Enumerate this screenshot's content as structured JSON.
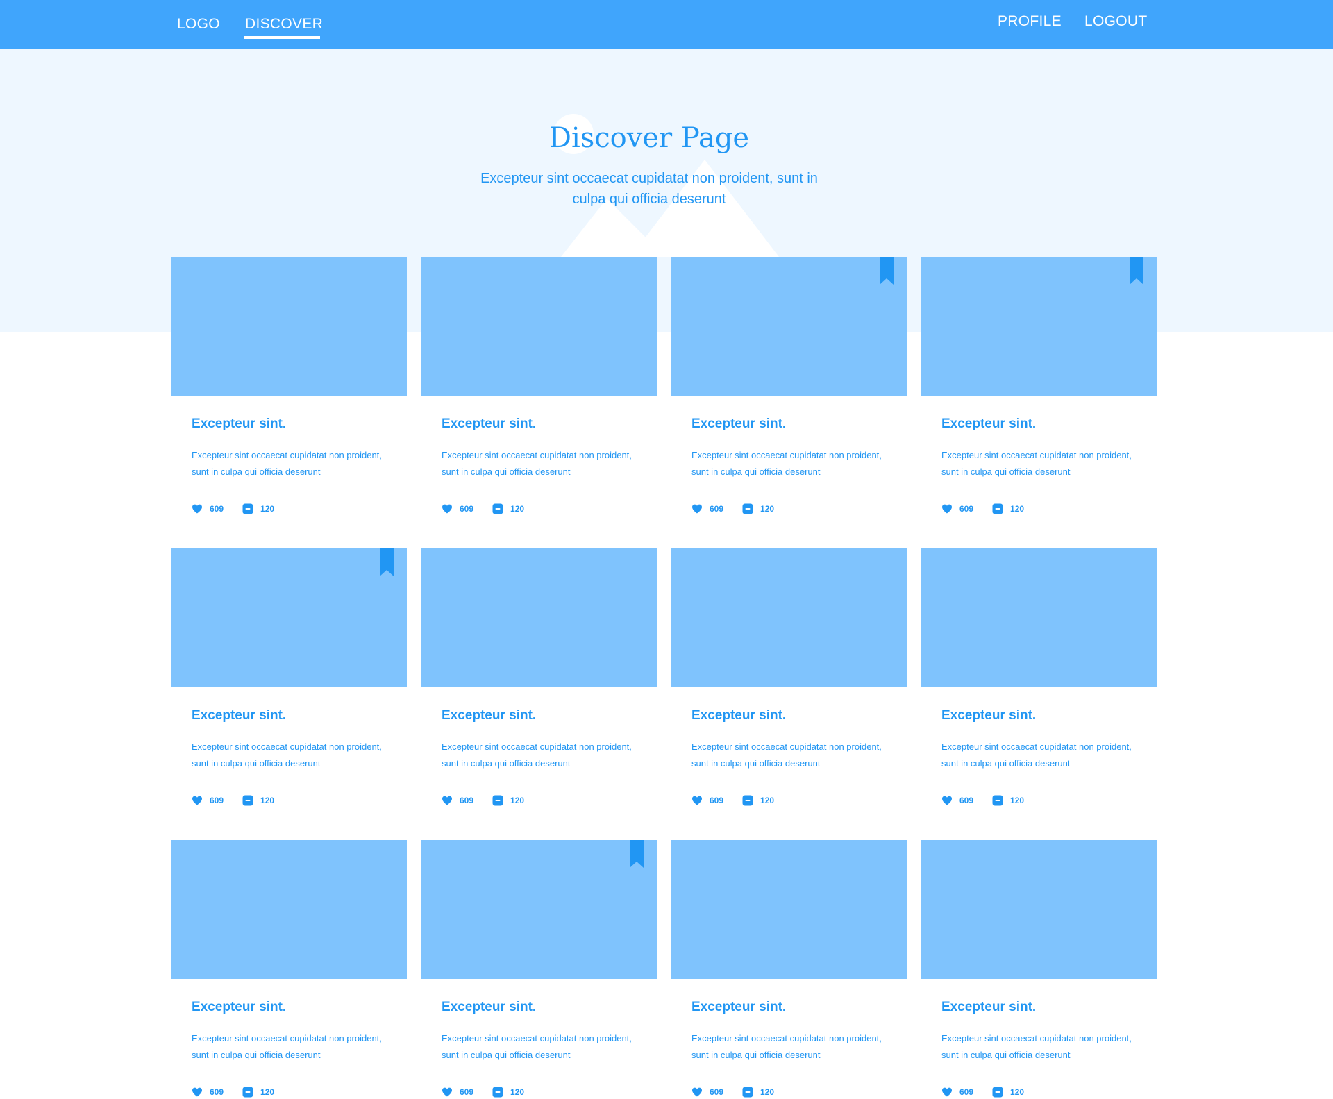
{
  "nav": {
    "logo": "LOGO",
    "discover": "DISCOVER",
    "profile": "PROFILE",
    "logout": "LOGOUT"
  },
  "hero": {
    "title": "Discover Page",
    "subtitle": "Excepteur sint occaecat cupidatat non proident, sunt in culpa qui officia deserunt"
  },
  "colors": {
    "nav_bg": "#40a5fc",
    "hero_bg": "#eef7ff",
    "accent": "#2196f3",
    "card_image": "#7fc3fd"
  },
  "cards": [
    {
      "title": "Excepteur sint.",
      "description": "Excepteur sint occaecat cupidatat non proident, sunt in culpa qui officia deserunt",
      "likes": "609",
      "comments": "120",
      "bookmarked": false
    },
    {
      "title": "Excepteur sint.",
      "description": "Excepteur sint occaecat cupidatat non proident, sunt in culpa qui officia deserunt",
      "likes": "609",
      "comments": "120",
      "bookmarked": false
    },
    {
      "title": "Excepteur sint.",
      "description": "Excepteur sint occaecat cupidatat non proident, sunt in culpa qui officia deserunt",
      "likes": "609",
      "comments": "120",
      "bookmarked": true
    },
    {
      "title": "Excepteur sint.",
      "description": "Excepteur sint occaecat cupidatat non proident, sunt in culpa qui officia deserunt",
      "likes": "609",
      "comments": "120",
      "bookmarked": true
    },
    {
      "title": "Excepteur sint.",
      "description": "Excepteur sint occaecat cupidatat non proident, sunt in culpa qui officia deserunt",
      "likes": "609",
      "comments": "120",
      "bookmarked": true
    },
    {
      "title": "Excepteur sint.",
      "description": "Excepteur sint occaecat cupidatat non proident, sunt in culpa qui officia deserunt",
      "likes": "609",
      "comments": "120",
      "bookmarked": false
    },
    {
      "title": "Excepteur sint.",
      "description": "Excepteur sint occaecat cupidatat non proident, sunt in culpa qui officia deserunt",
      "likes": "609",
      "comments": "120",
      "bookmarked": false
    },
    {
      "title": "Excepteur sint.",
      "description": "Excepteur sint occaecat cupidatat non proident, sunt in culpa qui officia deserunt",
      "likes": "609",
      "comments": "120",
      "bookmarked": false
    },
    {
      "title": "Excepteur sint.",
      "description": "Excepteur sint occaecat cupidatat non proident, sunt in culpa qui officia deserunt",
      "likes": "609",
      "comments": "120",
      "bookmarked": false
    },
    {
      "title": "Excepteur sint.",
      "description": "Excepteur sint occaecat cupidatat non proident, sunt in culpa qui officia deserunt",
      "likes": "609",
      "comments": "120",
      "bookmarked": true
    },
    {
      "title": "Excepteur sint.",
      "description": "Excepteur sint occaecat cupidatat non proident, sunt in culpa qui officia deserunt",
      "likes": "609",
      "comments": "120",
      "bookmarked": false
    },
    {
      "title": "Excepteur sint.",
      "description": "Excepteur sint occaecat cupidatat non proident, sunt in culpa qui officia deserunt",
      "likes": "609",
      "comments": "120",
      "bookmarked": false
    }
  ]
}
